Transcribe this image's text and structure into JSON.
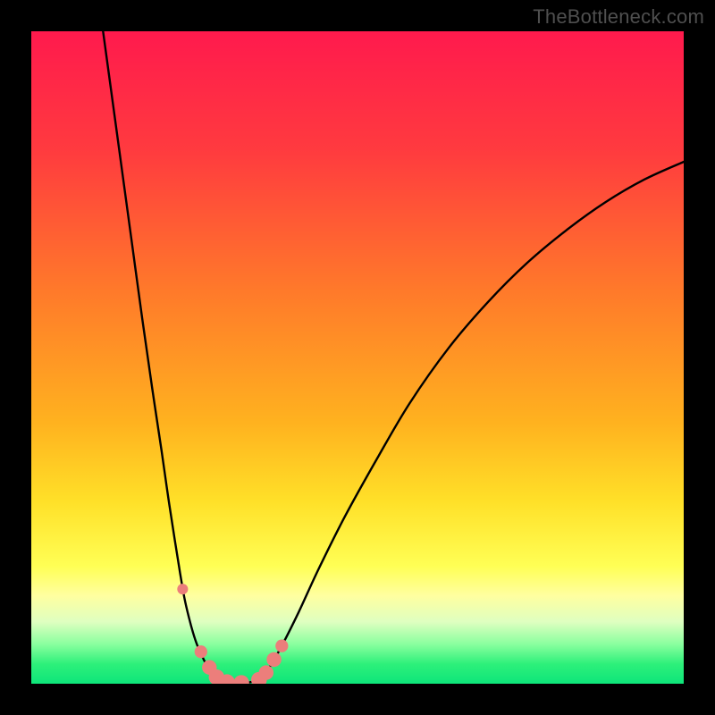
{
  "watermark": "TheBottleneck.com",
  "chart_data": {
    "type": "line",
    "title": "",
    "xlabel": "",
    "ylabel": "",
    "xlim": [
      0,
      100
    ],
    "ylim": [
      0,
      100
    ],
    "grid": false,
    "legend": false,
    "gradient_stops": [
      {
        "offset": 0.0,
        "color": "#ff1a4d"
      },
      {
        "offset": 0.18,
        "color": "#ff3a3f"
      },
      {
        "offset": 0.4,
        "color": "#ff7a2a"
      },
      {
        "offset": 0.6,
        "color": "#ffb21f"
      },
      {
        "offset": 0.72,
        "color": "#ffe028"
      },
      {
        "offset": 0.82,
        "color": "#ffff55"
      },
      {
        "offset": 0.865,
        "color": "#ffffa0"
      },
      {
        "offset": 0.905,
        "color": "#dfffc0"
      },
      {
        "offset": 0.94,
        "color": "#88ff9e"
      },
      {
        "offset": 0.97,
        "color": "#2df07a"
      },
      {
        "offset": 1.0,
        "color": "#0ee57a"
      }
    ],
    "series": [
      {
        "name": "left-curve",
        "color": "#000000",
        "x": [
          11.0,
          12.5,
          14.0,
          15.5,
          17.0,
          18.5,
          20.0,
          21.0,
          22.0,
          22.8,
          23.5,
          24.2,
          24.8,
          25.4,
          26.1,
          26.7,
          27.4,
          28.1,
          29.0
        ],
        "y": [
          100.0,
          89.0,
          78.0,
          67.0,
          56.0,
          45.5,
          35.5,
          28.5,
          22.0,
          17.0,
          13.0,
          10.0,
          7.8,
          6.0,
          4.4,
          3.2,
          2.2,
          1.3,
          0.6
        ]
      },
      {
        "name": "valley",
        "color": "#000000",
        "x": [
          29.0,
          30.0,
          31.0,
          32.0,
          33.0,
          34.0,
          35.2
        ],
        "y": [
          0.6,
          0.25,
          0.12,
          0.1,
          0.15,
          0.35,
          0.9
        ]
      },
      {
        "name": "right-curve",
        "color": "#000000",
        "x": [
          35.2,
          36.5,
          38.5,
          41.0,
          44.0,
          48.0,
          53.0,
          58.0,
          64.0,
          70.0,
          76.0,
          82.0,
          88.0,
          94.0,
          100.0
        ],
        "y": [
          0.9,
          2.5,
          6.0,
          11.0,
          17.5,
          25.5,
          34.5,
          43.0,
          51.5,
          58.5,
          64.5,
          69.5,
          73.8,
          77.3,
          80.0
        ]
      }
    ],
    "markers": {
      "name": "highlight-dots",
      "color": "#ec7e7b",
      "points": [
        {
          "x": 23.2,
          "y": 14.5,
          "r": 1.1
        },
        {
          "x": 26.0,
          "y": 4.9,
          "r": 1.3
        },
        {
          "x": 27.3,
          "y": 2.5,
          "r": 1.5
        },
        {
          "x": 28.4,
          "y": 1.0,
          "r": 1.6
        },
        {
          "x": 30.0,
          "y": 0.25,
          "r": 1.6
        },
        {
          "x": 32.2,
          "y": 0.12,
          "r": 1.6
        },
        {
          "x": 34.9,
          "y": 0.6,
          "r": 1.6
        },
        {
          "x": 36.0,
          "y": 1.7,
          "r": 1.5
        },
        {
          "x": 37.2,
          "y": 3.7,
          "r": 1.5
        },
        {
          "x": 38.4,
          "y": 5.8,
          "r": 1.3
        }
      ]
    }
  }
}
